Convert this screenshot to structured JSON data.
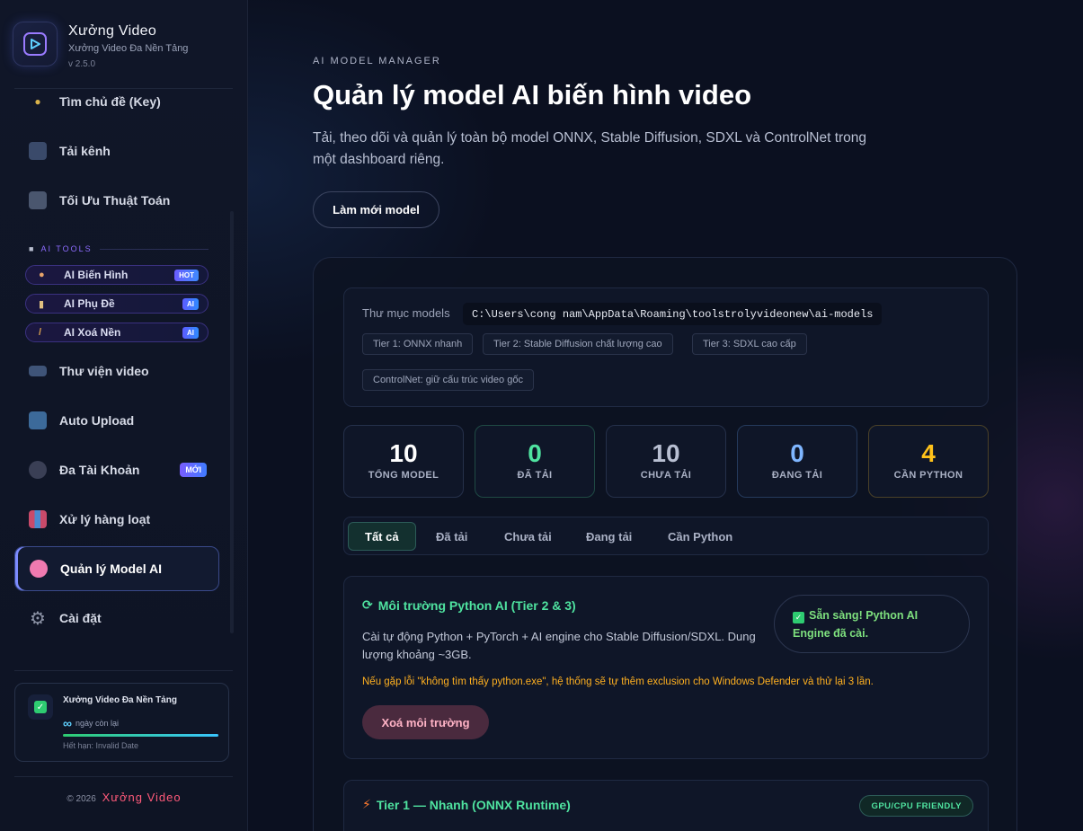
{
  "brand": {
    "name": "Xưởng Video",
    "subtitle": "Xưởng Video Đa Nền Tảng",
    "version": "v 2.5.0"
  },
  "nav": {
    "partial_item": "Tìm chủ đề (Key)",
    "items": [
      {
        "label": "Tải kênh",
        "icon": "tv-icon"
      },
      {
        "label": "Tối Ưu Thuật Toán",
        "icon": "control-knobs-icon"
      },
      {
        "label": "Thư viện video",
        "icon": "film-strip-icon"
      },
      {
        "label": "Auto Upload",
        "icon": "inbox-tray-icon"
      },
      {
        "label": "Đa Tài Khoản",
        "icon": "users-icon",
        "badge": "MỚI"
      },
      {
        "label": "Xử lý hàng loạt",
        "icon": "bar-chart-icon"
      },
      {
        "label": "Quản lý Model AI",
        "icon": "brain-icon",
        "active": true
      },
      {
        "label": "Cài đặt",
        "icon": "gear-icon"
      }
    ],
    "section_label": "AI TOOLS",
    "ai_tools": [
      {
        "label": "AI Biến Hình",
        "badge": "HOT",
        "icon": "palette-icon"
      },
      {
        "label": "AI Phụ Đề",
        "badge": "AI",
        "icon": "memo-icon"
      },
      {
        "label": "AI Xoá Nền",
        "badge": "AI",
        "icon": "broom-icon"
      }
    ]
  },
  "license": {
    "title": "Xưởng Video Đa Nền Tảng",
    "days_symbol": "∞",
    "days_label": "ngày còn lại",
    "expiry": "Hết hạn: Invalid Date"
  },
  "copyright": {
    "prefix": "© 2026",
    "brand": "Xưởng Video"
  },
  "header": {
    "eyebrow": "AI MODEL MANAGER",
    "title": "Quản lý model AI biến hình video",
    "subtitle": "Tải, theo dõi và quản lý toàn bộ model ONNX, Stable Diffusion, SDXL và ControlNet trong một dashboard riêng.",
    "refresh_button": "Làm mới model"
  },
  "models_dir": {
    "label": "Thư mục models",
    "path": "C:\\Users\\cong nam\\AppData\\Roaming\\toolstrolyvideonew\\ai-models",
    "chips": [
      "Tier 1: ONNX nhanh",
      "Tier 2: Stable Diffusion chất lượng cao",
      "Tier 3: SDXL cao cấp",
      "ControlNet: giữ cấu trúc video gốc"
    ]
  },
  "stats": [
    {
      "value": "10",
      "label": "TỔNG MODEL",
      "color": "#ffffff",
      "border": "#25304a"
    },
    {
      "value": "0",
      "label": "ĐÃ TẢI",
      "color": "#4fe3a0",
      "border": "#1f4a44"
    },
    {
      "value": "10",
      "label": "CHƯA TẢI",
      "color": "#b8bfd2",
      "border": "#25304a"
    },
    {
      "value": "0",
      "label": "ĐANG TẢI",
      "color": "#7fb6ff",
      "border": "#253a5c"
    },
    {
      "value": "4",
      "label": "CẦN PYTHON",
      "color": "#ffc21a",
      "border": "#4a4128"
    }
  ],
  "tabs": [
    {
      "label": "Tất cả",
      "active": true
    },
    {
      "label": "Đã tải"
    },
    {
      "label": "Chưa tải"
    },
    {
      "label": "Đang tải"
    },
    {
      "label": "Cần Python"
    }
  ],
  "python_env": {
    "title": "Môi trường Python AI (Tier 2 & 3)",
    "description": "Cài tự động Python + PyTorch + AI engine cho Stable Diffusion/SDXL. Dung lượng khoảng ~3GB.",
    "warning": "Nếu gặp lỗi \"không tìm thấy python.exe\", hệ thống sẽ tự thêm exclusion cho Windows Defender và thử lại 3 lần.",
    "status": "Sẵn sàng! Python AI Engine đã cài.",
    "delete_button": "Xoá môi trường"
  },
  "tier1": {
    "title": "Tier 1 — Nhanh (ONNX Runtime)",
    "badge": "GPU/CPU FRIENDLY"
  }
}
